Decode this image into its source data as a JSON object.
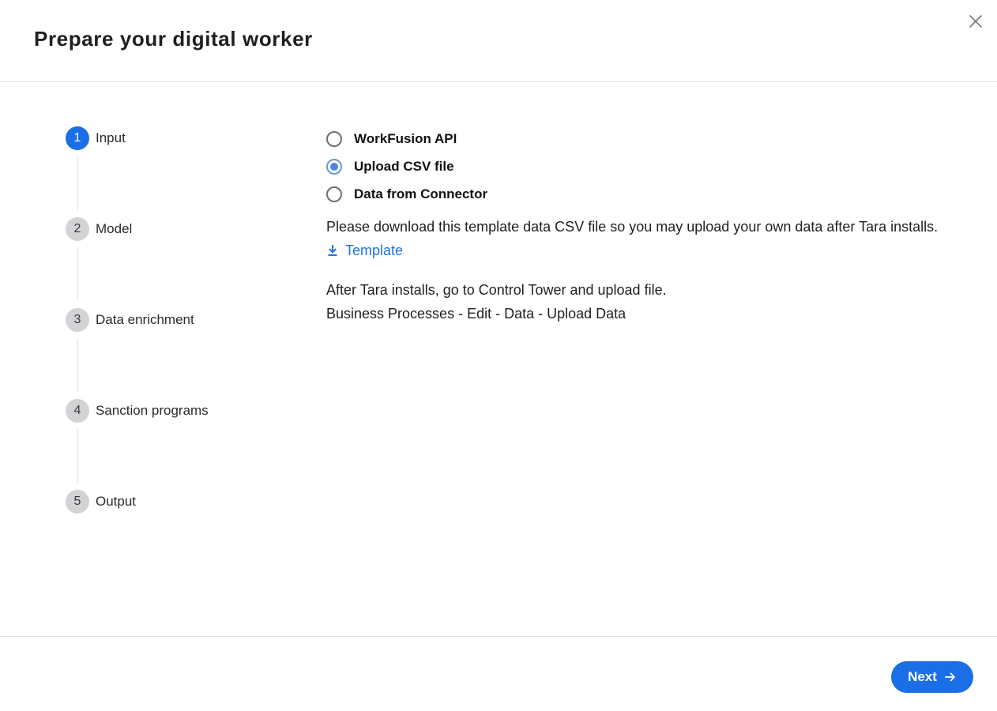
{
  "dialog": {
    "title": "Prepare your digital worker",
    "close_icon": "close-icon"
  },
  "stepper": {
    "steps": [
      {
        "number": "1",
        "label": "Input",
        "active": true
      },
      {
        "number": "2",
        "label": "Model",
        "active": false
      },
      {
        "number": "3",
        "label": "Data enrichment",
        "active": false
      },
      {
        "number": "4",
        "label": "Sanction programs",
        "active": false
      },
      {
        "number": "5",
        "label": "Output",
        "active": false
      }
    ]
  },
  "input_options": {
    "options": [
      {
        "label": "WorkFusion API",
        "selected": false
      },
      {
        "label": "Upload CSV file",
        "selected": true
      },
      {
        "label": "Data from Connector",
        "selected": false
      }
    ]
  },
  "content": {
    "description": "Please download this template data CSV file so you may upload your own data after Tara installs.",
    "template_link": "Template",
    "template_icon": "download-icon",
    "info_line1": "After Tara installs, go to Control Tower and upload file.",
    "info_line2": "Business Processes - Edit - Data - Upload Data"
  },
  "footer": {
    "next_label": "Next",
    "next_icon": "arrow-right-icon"
  },
  "colors": {
    "primary": "#1a6ee6",
    "link": "#1f72e0",
    "step_inactive": "#d3d3d6"
  }
}
